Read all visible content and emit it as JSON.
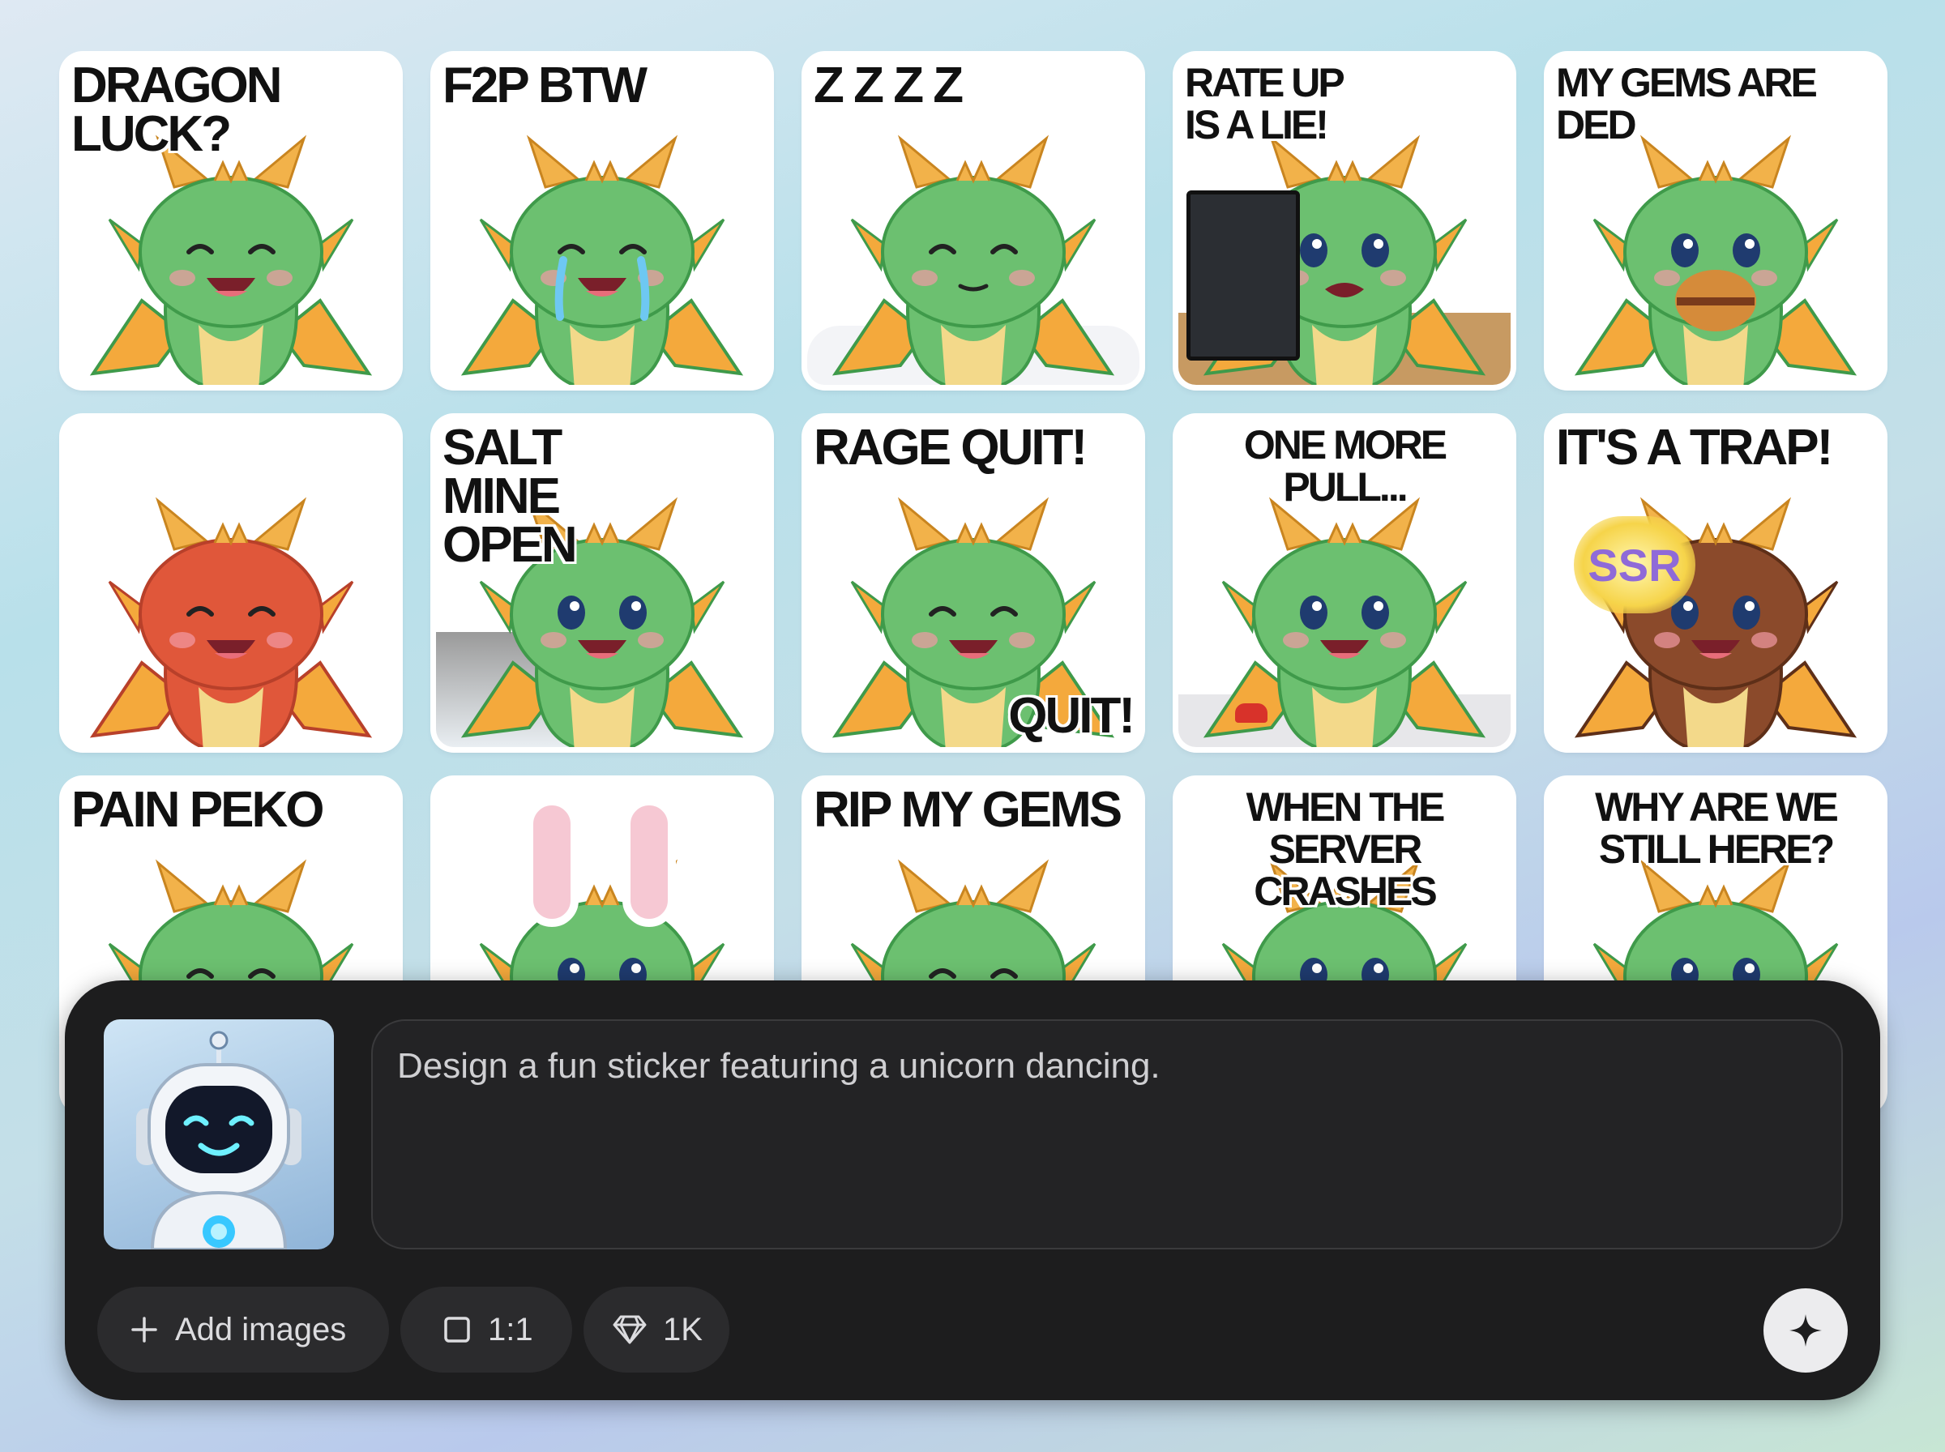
{
  "stickers": [
    {
      "caption": "DRAGON LUCK?",
      "mood": "happy",
      "color": "#6cc070"
    },
    {
      "caption": "F2P BTW",
      "mood": "crying",
      "color": "#6cc070"
    },
    {
      "caption": "Z Z Z Z",
      "mood": "sleeping",
      "color": "#6cc070"
    },
    {
      "caption": "RATE UP\nIS A LIE!",
      "mood": "angry",
      "color": "#6cc070"
    },
    {
      "caption": "MY GEMS ARE\nDED",
      "mood": "eating",
      "color": "#6cc070"
    },
    {
      "caption": "",
      "mood": "furious",
      "color": "#e0573a"
    },
    {
      "caption": "SALT\nMINE\nOPEN",
      "mood": "digging",
      "color": "#6cc070"
    },
    {
      "caption": "RAGE QUIT!",
      "caption2": "QUIT!",
      "mood": "raging",
      "color": "#6cc070"
    },
    {
      "caption": "ONE MORE\nPULL...",
      "mood": "hopeful",
      "color": "#6cc070"
    },
    {
      "caption": "IT'S A TRAP!",
      "badge": "SSR",
      "mood": "trap",
      "color": "#8b4a2b"
    },
    {
      "caption": "PAIN PEKO",
      "mood": "sad",
      "color": "#6cc070"
    },
    {
      "caption": "",
      "mood": "bunny",
      "color": "#6cc070"
    },
    {
      "caption": "RIP MY GEMS",
      "mood": "sad",
      "color": "#6cc070"
    },
    {
      "caption": "WHEN THE\nSERVER CRASHES",
      "mood": "worried",
      "color": "#6cc070"
    },
    {
      "caption": "WHY ARE WE\nSTILL HERE?",
      "mood": "worried",
      "color": "#6cc070"
    }
  ],
  "composer": {
    "prompt_value": "Design a fun sticker featuring a unicorn dancing.",
    "add_images_label": "Add images",
    "aspect_label": "1:1",
    "resolution_label": "1K"
  },
  "colors": {
    "composer_bg": "#1d1d1e",
    "pill_bg": "#2b2b2d",
    "dragon_green": "#6cc070",
    "horn_orange": "#f2b24a"
  }
}
